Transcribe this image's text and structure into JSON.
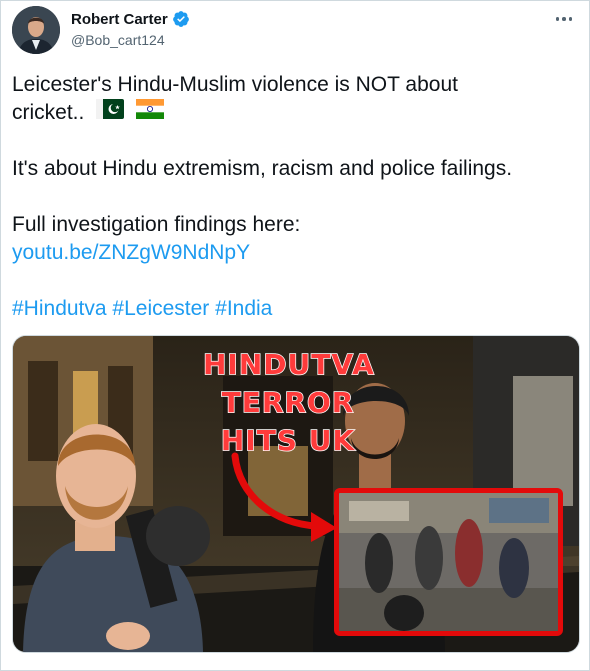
{
  "author": {
    "name": "Robert Carter",
    "handle": "@Bob_cart124",
    "verified": true,
    "avatar_icon": "profile-photo"
  },
  "tweet": {
    "line1": "Leicester's Hindu-Muslim violence is NOT about",
    "line2": "cricket..",
    "flags": [
      "pakistan-flag",
      "india-flag"
    ],
    "line3": "It's about Hindu extremism, racism and police failings.",
    "line4": "Full investigation findings here:",
    "link": "youtu.be/ZNZgW9NdNpY",
    "hashtags": [
      "#Hindutva",
      "#Leicester",
      "#India"
    ]
  },
  "media": {
    "overlay_text": [
      "HINDUTVA",
      "TERROR",
      "HITS UK"
    ]
  },
  "colors": {
    "link": "#1d9bf0",
    "verified": "#1d9bf0",
    "overlay_red": "#ff3b3b",
    "frame_red": "#e30a0a"
  }
}
